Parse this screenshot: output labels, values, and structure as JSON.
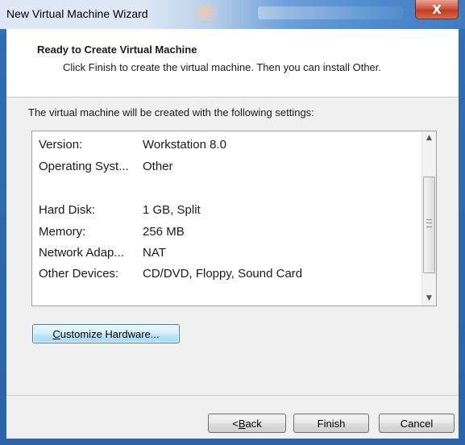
{
  "window": {
    "title": "New Virtual Machine Wizard",
    "close_label": "X"
  },
  "header": {
    "title": "Ready to Create Virtual Machine",
    "subtitle": "Click Finish to create the virtual machine. Then you can install Other."
  },
  "intro": "The virtual machine will be created with the following settings:",
  "settings": [
    {
      "key": "Version:",
      "value": "Workstation 8.0"
    },
    {
      "key": "Operating Syst...",
      "value": "Other"
    },
    {
      "key": "",
      "value": ""
    },
    {
      "key": "Hard Disk:",
      "value": "1 GB, Split"
    },
    {
      "key": "Memory:",
      "value": "256 MB"
    },
    {
      "key": "Network Adap...",
      "value": "NAT"
    },
    {
      "key": "Other Devices:",
      "value": "CD/DVD, Floppy, Sound Card"
    }
  ],
  "customize_button": {
    "accel": "C",
    "rest": "ustomize Hardware..."
  },
  "buttons": {
    "back_prefix": "< ",
    "back_accel": "B",
    "back_rest": "ack",
    "finish": "Finish",
    "cancel": "Cancel"
  },
  "icons": {
    "scroll_up": "scroll-up-arrow",
    "scroll_down": "scroll-down-arrow"
  }
}
